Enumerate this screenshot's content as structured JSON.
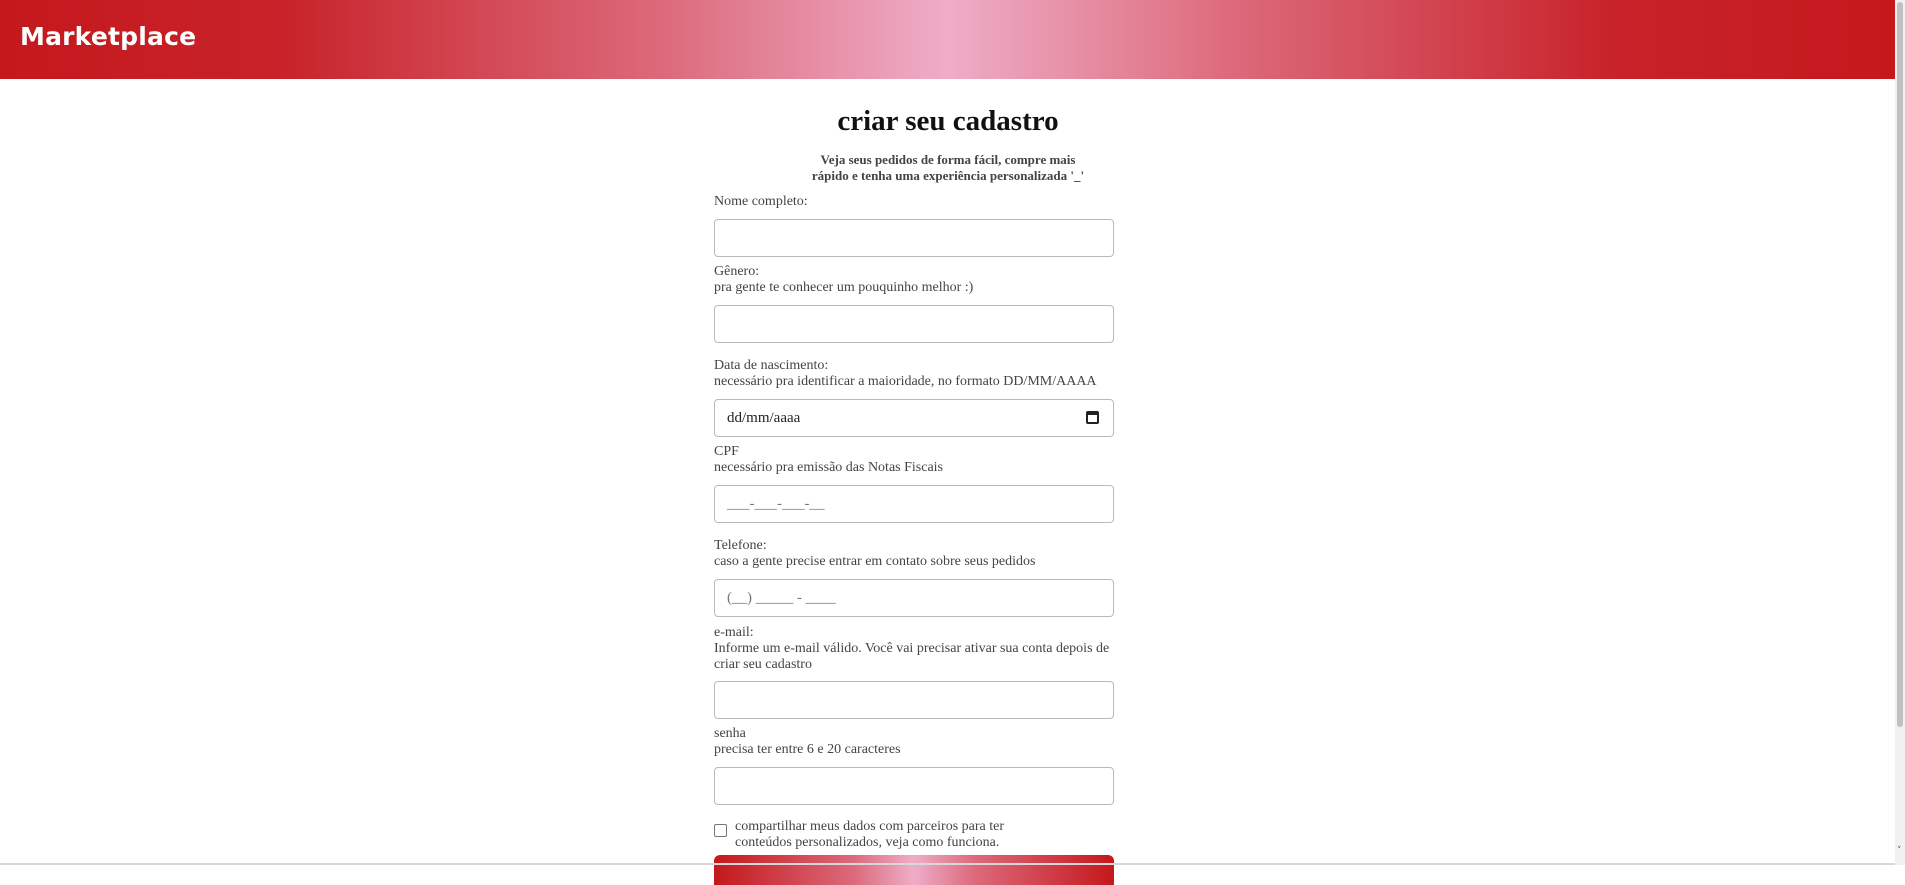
{
  "header": {
    "brand": "Marketplace"
  },
  "form": {
    "title": "criar seu cadastro",
    "subtitle_line1": "Veja seus pedidos de forma fácil, compre mais",
    "subtitle_line2": "rápido e tenha uma experiência personalizada '_'",
    "fields": {
      "name": {
        "label": "Nome completo:",
        "value": ""
      },
      "gender": {
        "label": "Gênero:",
        "hint": "pra gente te conhecer um pouquinho melhor :)",
        "value": ""
      },
      "birthdate": {
        "label": "Data de nascimento:",
        "hint": "necessário pra identificar a maioridade, no formato DD/MM/AAAA",
        "placeholder": "dd/mm/aaaa"
      },
      "cpf": {
        "label": "CPF",
        "hint": "necessário pra emissão das Notas Fiscais",
        "mask": "___-___-___-__"
      },
      "phone": {
        "label": "Telefone:",
        "hint": "caso a gente precise entrar em contato sobre seus pedidos",
        "mask": "(__) _____ - ____"
      },
      "email": {
        "label": "e-mail:",
        "hint_line1": "Informe um e-mail válido. Você vai precisar ativar sua conta depois de",
        "hint_line2": "criar seu cadastro",
        "value": ""
      },
      "password": {
        "label": "senha",
        "hint": "precisa ter entre 6 e 20 caracteres",
        "value": ""
      }
    },
    "share_data": {
      "checked": false,
      "label_line1": "compartilhar meus dados com parceiros para ter",
      "label_line2": "conteúdos personalizados, veja como funciona."
    },
    "icons": {
      "calendar": "calendar-icon"
    },
    "colors": {
      "accent": "#c4181c",
      "accent_light": "#efadc8"
    }
  }
}
